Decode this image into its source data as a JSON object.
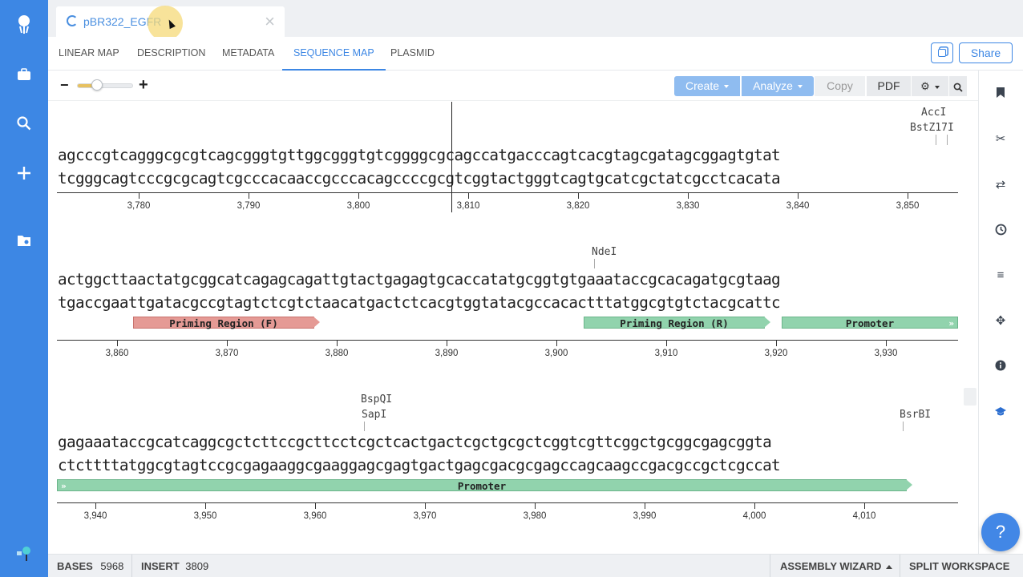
{
  "doc_tab": {
    "name": "pBR322_EGFR"
  },
  "nav": {
    "tabs": [
      "LINEAR MAP",
      "DESCRIPTION",
      "METADATA",
      "SEQUENCE MAP",
      "PLASMID"
    ],
    "active": "SEQUENCE MAP",
    "share_label": "Share"
  },
  "toolbar": {
    "zoom_level": 0.35,
    "create_label": "Create",
    "analyze_label": "Analyze",
    "copy_label": "Copy",
    "pdf_label": "PDF"
  },
  "rows": [
    {
      "top": "agcccgtcagggcgcgtcagcgggtgttggcgggtgtcggggcgcagccatgacccagtcacgtagcgatagcggagtgtat",
      "bottom": "tcgggcagtcccgcgcagtcgcccacaaccgcccacagccccgcgtcggtactgggtcagtgcatcgctatcgcctcacata",
      "ticks": [
        "3,780",
        "3,790",
        "3,800",
        "3,810",
        "3,820",
        "3,830",
        "3,840",
        "3,850"
      ],
      "enzymes": [
        {
          "name": "AccI"
        },
        {
          "name": "BstZ17I"
        }
      ],
      "features": []
    },
    {
      "top": "actggcttaactatgcggcatcagagcagattgtactgagagtgcaccatatgcggtgtgaaataccgcacagatgcgtaag",
      "bottom": "tgaccgaattgatacgccgtagtctcgtctaacatgactctcacgtggtatacgccacactttatggcgtgtctacgcattc",
      "ticks": [
        "3,860",
        "3,870",
        "3,880",
        "3,890",
        "3,900",
        "3,910",
        "3,920",
        "3,930"
      ],
      "enzymes": [
        {
          "name": "NdeI"
        }
      ],
      "features": [
        {
          "label": "Priming Region (F)",
          "color": "#e59a95"
        },
        {
          "label": "Priming Region (R)",
          "color": "#91d3ad"
        },
        {
          "label": "Promoter",
          "color": "#91d3ad"
        }
      ]
    },
    {
      "top": "gagaaataccgcatcaggcgctcttccgcttcctcgctcactgactcgctgcgctcggtcgttcggctgcggcgagcggta",
      "bottom": "ctcttttatggcgtagtccgcgagaaggcgaaggagcgagtgactgagcgacgcgagccagcaagccgacgccgctcgccat",
      "ticks": [
        "3,940",
        "3,950",
        "3,960",
        "3,970",
        "3,980",
        "3,990",
        "4,000",
        "4,010"
      ],
      "enzymes": [
        {
          "name": "BspQI"
        },
        {
          "name": "SapI"
        },
        {
          "name": "BsrBI"
        }
      ],
      "features": [
        {
          "label": "Promoter",
          "color": "#91d3ad"
        }
      ]
    }
  ],
  "status": {
    "bases_label": "BASES",
    "bases_value": "5968",
    "insert_label": "INSERT",
    "insert_value": "3809",
    "assembly_label": "ASSEMBLY WIZARD",
    "split_label": "SPLIT WORKSPACE"
  },
  "help_label": "?"
}
